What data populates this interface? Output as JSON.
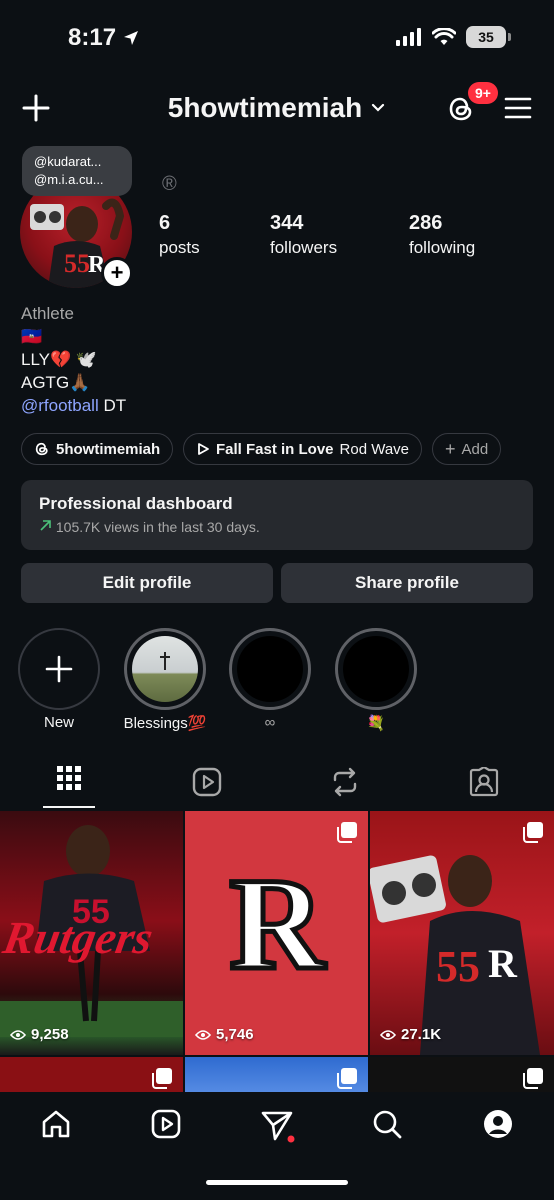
{
  "status_bar": {
    "time": "8:17",
    "battery": "35"
  },
  "header": {
    "username": "5howtimemiah",
    "threads_badge": "9+"
  },
  "profile": {
    "note_lines": [
      "@kudarat...",
      "@m.i.a.cu..."
    ],
    "registered_mark": "®",
    "stats": [
      {
        "value": "6",
        "label": "posts"
      },
      {
        "value": "344",
        "label": "followers"
      },
      {
        "value": "286",
        "label": "following"
      }
    ],
    "bio": {
      "category": "Athlete",
      "line1": "🇭🇹",
      "line2": "LLY💔 🕊️",
      "line3": "AGTG🙏🏾",
      "mention": "@rfootball",
      "mention_suffix": " DT"
    }
  },
  "chips": {
    "threads_handle": "5howtimemiah",
    "song_title": "Fall Fast in Love",
    "song_artist": "Rod Wave",
    "add_label": "Add"
  },
  "dashboard": {
    "title": "Professional dashboard",
    "subtitle": "105.7K views in the last 30 days."
  },
  "buttons": {
    "edit": "Edit profile",
    "share": "Share profile"
  },
  "highlights": [
    {
      "label": "New"
    },
    {
      "label": "Blessings💯"
    },
    {
      "label": "∞"
    },
    {
      "label": "💐"
    }
  ],
  "posts": [
    {
      "views": "9,258",
      "overlay_text": "Rutgers"
    },
    {
      "views": "5,746",
      "letter": "R"
    },
    {
      "views": "27.1K"
    }
  ],
  "colors": {
    "background": "#0c1014",
    "accent_red": "#cc0033",
    "link": "#8ea5ff",
    "badge": "#ff3040"
  }
}
